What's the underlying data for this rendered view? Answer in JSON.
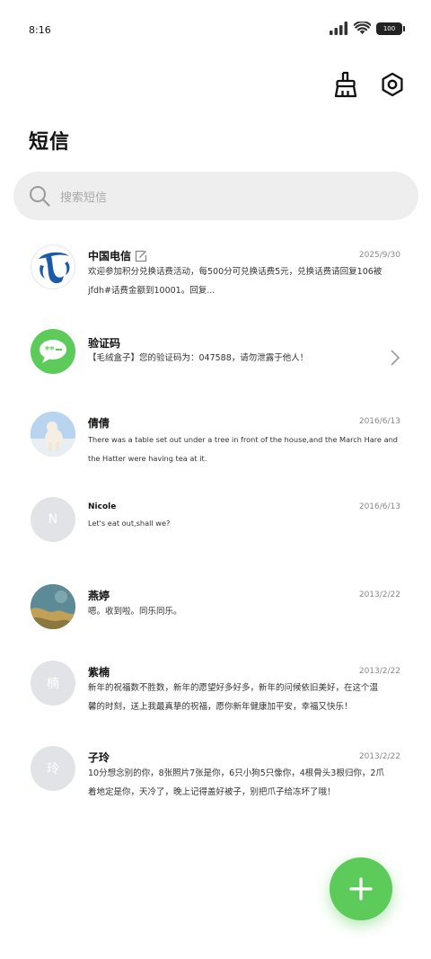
{
  "status_bar": {
    "time": "8:16",
    "battery": "100"
  },
  "header": {
    "title": "短信"
  },
  "search": {
    "placeholder": "搜索短信"
  },
  "messages": [
    {
      "name": "中国电信",
      "date": "2025/9/30",
      "line1": "欢迎参加积分兑换话费活动，每500分可兑换话费5元，兑换话费请回复106被",
      "line2": "jfdh#话费金额到10001。回复..."
    },
    {
      "name": "验证码",
      "date": "",
      "line1": "【毛绒盒子】您的验证码为：047588，请勿泄露于他人！",
      "line2": ""
    },
    {
      "name": "倩倩",
      "date": "2016/6/13",
      "line1": "There was a table set out under a tree in front of the house,and the March Hare and",
      "line2": "the Hatter were having tea at it."
    },
    {
      "name": "Nicole",
      "date": "2016/6/13",
      "avatar_letter": "N",
      "line1": "Let's eat out,shall we?",
      "line2": ""
    },
    {
      "name": "燕婷",
      "date": "2013/2/22",
      "line1": "嗯。收到啦。同乐同乐。",
      "line2": ""
    },
    {
      "name": "紫楠",
      "date": "2013/2/22",
      "avatar_letter": "楠",
      "line1": "新年的祝福数不胜数，新年的愿望好多好多，新年的问候依旧美好，在这个温",
      "line2": "馨的时刻，送上我最真挚的祝福，愿你新年健康加平安，幸福又快乐！"
    },
    {
      "name": "子玲",
      "date": "2013/2/22",
      "avatar_letter": "玲",
      "line1": "10分想念别的你，8张照片7张是你，6只小狗5只像你，4根骨头3根归你，2爪",
      "line2": "着地定是你，天冷了，晚上记得盖好被子，别把爪子给冻坏了哦！"
    }
  ],
  "colors": {
    "accent": "#5ccb5a",
    "search_bg": "#eeeeee",
    "placeholder": "#a9a9a9"
  }
}
